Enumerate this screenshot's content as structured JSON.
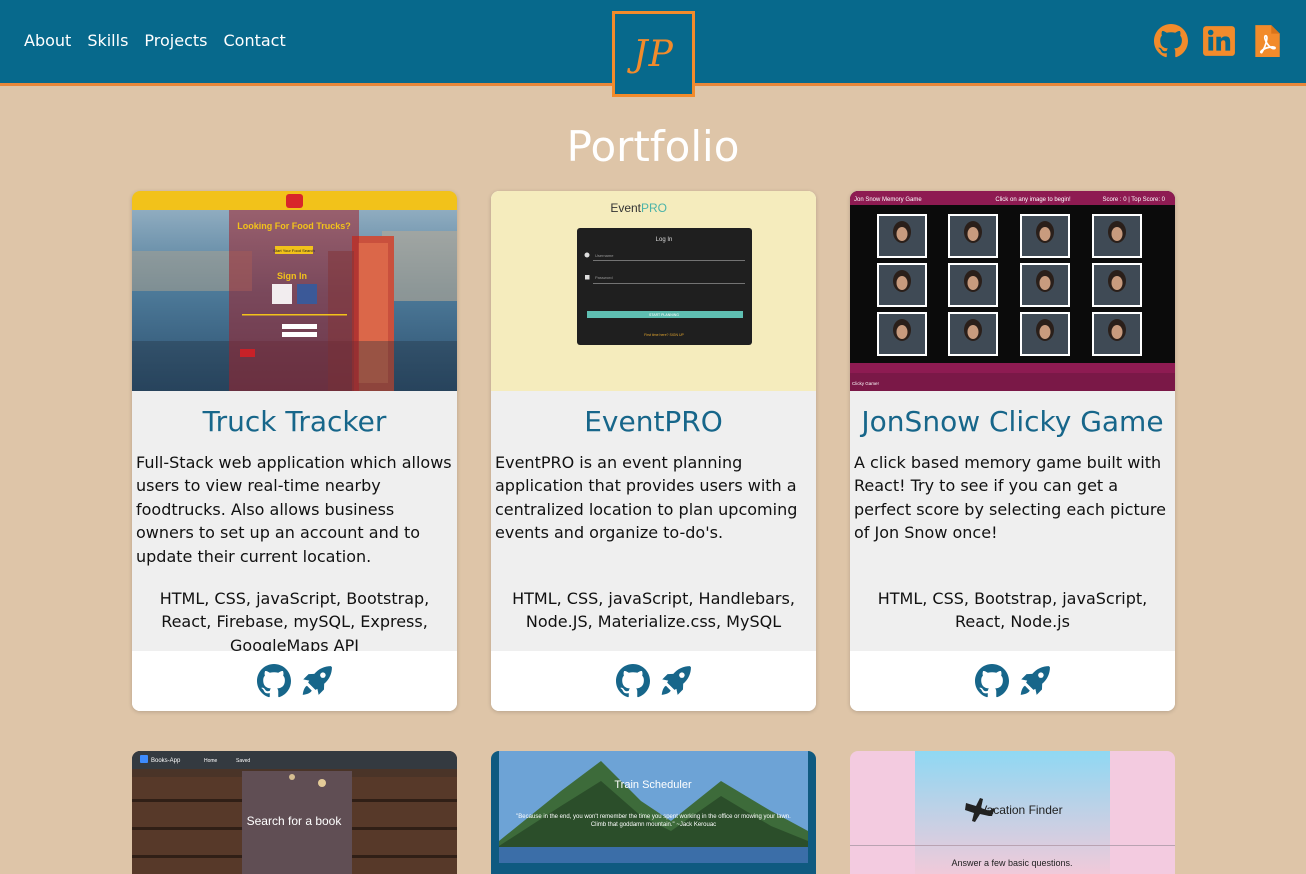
{
  "nav": {
    "links": [
      "About",
      "Skills",
      "Projects",
      "Contact"
    ],
    "logo_text": "JP",
    "social": [
      "github-icon",
      "linkedin-icon",
      "pdf-icon"
    ],
    "accent_color": "#f28b2b",
    "bar_color": "#07698c"
  },
  "portfolio": {
    "heading": "Portfolio",
    "cards": [
      {
        "title": "Truck Tracker",
        "description": "Full-Stack web application which allows users to view real-time nearby foodtrucks. Also allows business owners to set up an account and to update their current location.",
        "tech": "HTML, CSS, javaScript, Bootstrap, React, Firebase, mySQL, Express, GoogleMaps API",
        "shot": {
          "heading": "Looking For Food Trucks?",
          "button": "Start Your Food Search",
          "signin": "Sign In"
        }
      },
      {
        "title": "EventPRO",
        "description": "EventPRO is an event planning application that provides users with a centralized location to plan upcoming events and organize to-do's.",
        "tech": "HTML, CSS, javaScript, Handlebars, Node.JS, Materialize.css, MySQL",
        "shot": {
          "brand_a": "Event",
          "brand_b": "PRO",
          "login": "Log In",
          "username": "Username",
          "password": "Password",
          "button": "START PLANNING",
          "signup": "First time here? SIGN UP"
        }
      },
      {
        "title": "JonSnow Clicky Game",
        "description": "A click based memory game built with React! Try to see if you can get a perfect score by selecting each picture of Jon Snow once!",
        "tech": "HTML, CSS, Bootstrap, javaScript, React, Node.js",
        "shot": {
          "left": "Jon Snow Memory Game",
          "center": "Click on any image to begin!",
          "right": "Score : 0 | Top Score: 0",
          "footer": "Clicky Game!"
        }
      }
    ],
    "row2": [
      {
        "nav_brand": "Books-App",
        "nav_home": "Home",
        "nav_saved": "Saved",
        "search": "Search for a book"
      },
      {
        "title": "Train Scheduler",
        "quote": "\"Because in the end, you won't remember the time you spent working in the office or mowing your lawn. Climb that goddamn mountain.\" ~Jack Kerouac"
      },
      {
        "title": "Vacation Finder",
        "subtitle": "Answer a few basic questions."
      }
    ]
  }
}
